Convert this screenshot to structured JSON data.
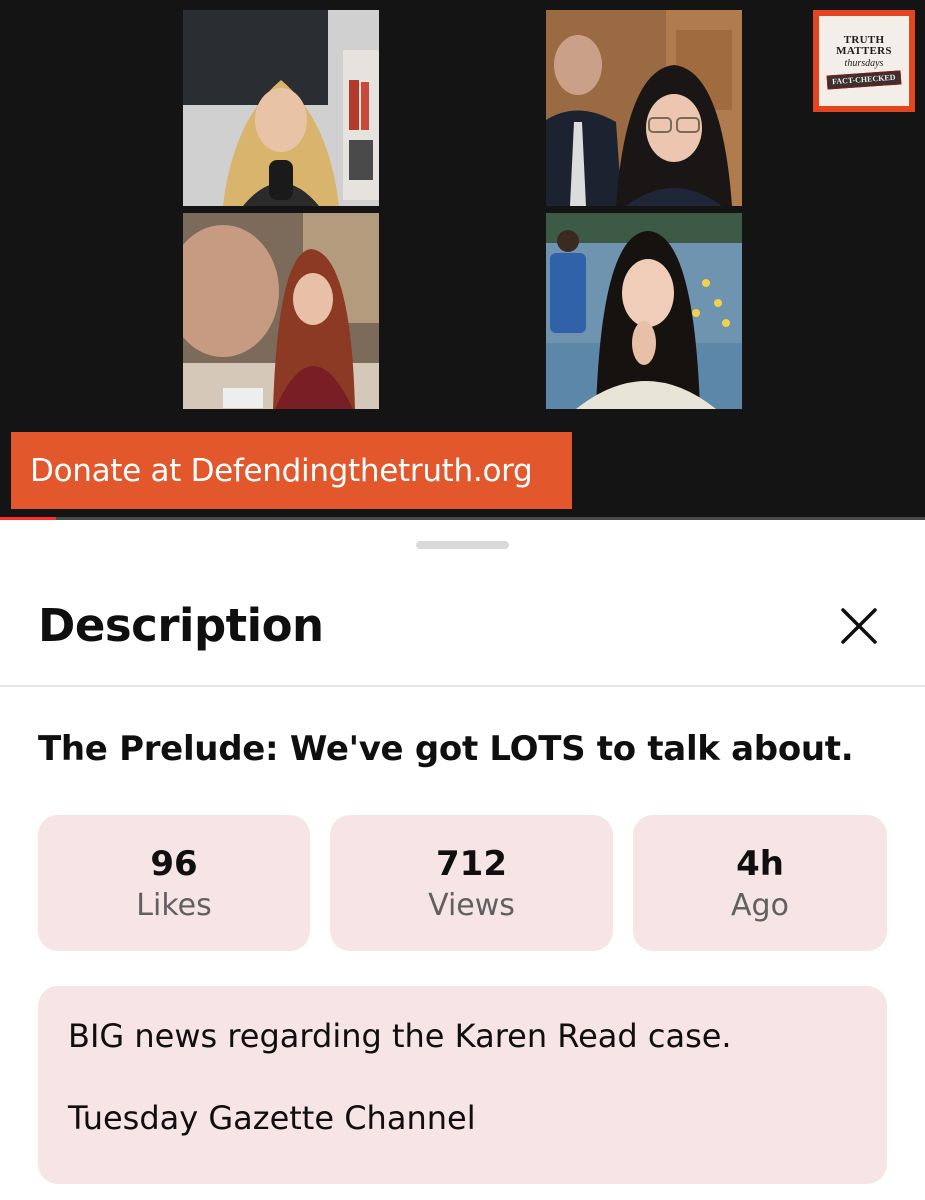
{
  "video": {
    "logo": {
      "line1": "TRUTH",
      "line2": "MATTERS",
      "line3": "thursdays",
      "stamp": "FACT-CHECKED"
    },
    "donate_text": "Donate at Defendingthetruth.org",
    "progress_fraction": 0.06,
    "tiles": [
      {
        "name": "participant-tile-1"
      },
      {
        "name": "participant-tile-2"
      },
      {
        "name": "participant-tile-3"
      },
      {
        "name": "participant-tile-4"
      }
    ]
  },
  "sheet": {
    "title": "Description",
    "close_icon": "close-icon"
  },
  "video_title": "The Prelude: We've got LOTS to talk about.",
  "stats": [
    {
      "value": "96",
      "label": "Likes"
    },
    {
      "value": "712",
      "label": "Views"
    },
    {
      "value": "4h",
      "label": "Ago"
    }
  ],
  "description": {
    "line1": "BIG news regarding the Karen Read case.",
    "line2": "Tuesday Gazette Channel"
  },
  "colors": {
    "accent": "#e2572b",
    "card_bg": "#f7e4e4",
    "video_bg": "#141414",
    "progress": "#ff2d2d"
  }
}
